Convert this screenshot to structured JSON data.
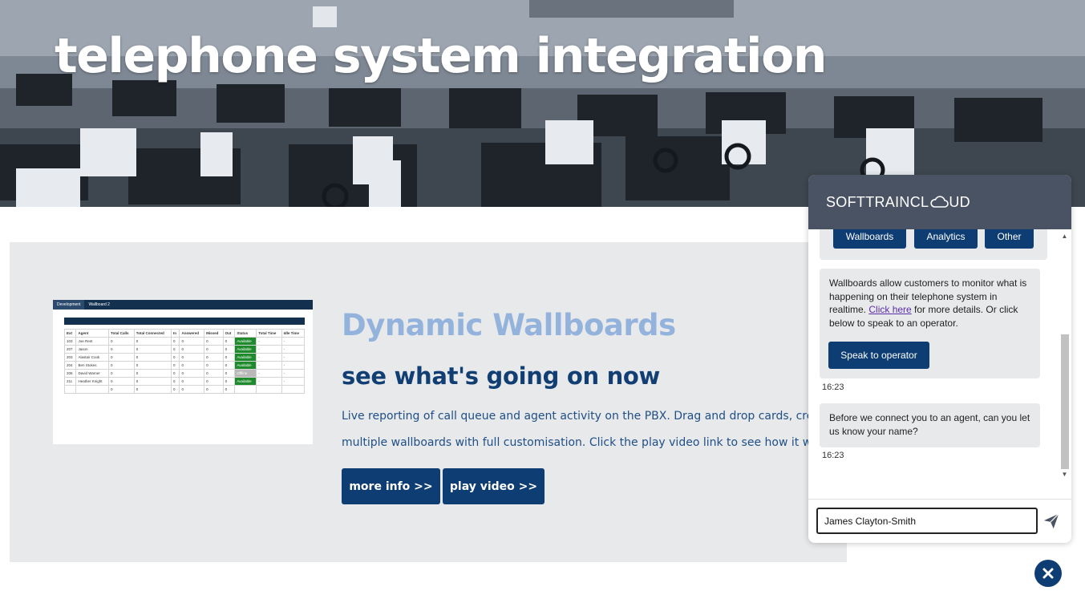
{
  "hero": {
    "title": "telephone system integration"
  },
  "feature": {
    "heading": "Dynamic Wallboards",
    "subheading": "see what's going on now",
    "description": "Live reporting of call queue and agent activity on the PBX. Drag and drop cards, create multiple wallboards with full customisation. Click the play video link to see how it works",
    "more_info_label": "more info >>",
    "play_video_label": "play video >>",
    "screenshot": {
      "tabs": [
        "Development",
        "Wallboard 2"
      ],
      "columns": [
        "Ext",
        "Agent",
        "Total Calls",
        "Total Connected",
        "In",
        "Answered",
        "Missed",
        "Out",
        "Status",
        "Total Time",
        "Idle Time"
      ],
      "rows": [
        [
          "103",
          "Joe Rent",
          "0",
          "0",
          "0",
          "0",
          "0",
          "0",
          "Available",
          "-",
          "-"
        ],
        [
          "207",
          "Jason",
          "0",
          "0",
          "0",
          "0",
          "0",
          "0",
          "Available",
          "-",
          "-"
        ],
        [
          "203",
          "Alastair Cook",
          "0",
          "0",
          "0",
          "0",
          "0",
          "0",
          "Available",
          "-",
          "-"
        ],
        [
          "204",
          "Ben Stokes",
          "0",
          "0",
          "0",
          "0",
          "0",
          "0",
          "Available",
          "-",
          "-"
        ],
        [
          "206",
          "David Warner",
          "0",
          "0",
          "0",
          "0",
          "0",
          "0",
          "Offline",
          "-",
          "-"
        ],
        [
          "211",
          "Heather Knight",
          "0",
          "0",
          "0",
          "0",
          "0",
          "0",
          "Available",
          "-",
          "-"
        ],
        [
          "",
          "",
          "0",
          "0",
          "0",
          "0",
          "0",
          "0",
          "",
          "",
          ""
        ]
      ]
    }
  },
  "chat": {
    "brand_left": "SOFTTRAINCL",
    "brand_right": "UD",
    "options": [
      "Wallboards",
      "Analytics",
      "Other"
    ],
    "message1_before": "Wallboards allow customers to monitor what is happening on their telephone system in realtime. ",
    "message1_link": "Click here",
    "message1_after": " for more details. Or click below to speak to an operator.",
    "speak_label": "Speak to operator",
    "time1": "16:23",
    "message2": "Before we connect you to an agent, can you let us know your name?",
    "time2": "16:23",
    "input_value": "James Clayton-Smith",
    "icons": {
      "send": "send-icon",
      "close": "close-icon",
      "cloud": "cloud-icon"
    }
  },
  "colors": {
    "navy": "#0e3d73",
    "heading_light": "#93b3dc",
    "section_bg": "#e8e9eb",
    "chat_header": "#4a5363"
  }
}
